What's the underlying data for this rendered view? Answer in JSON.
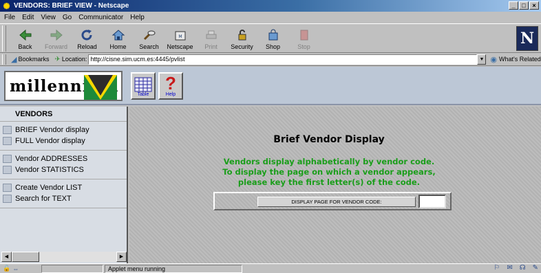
{
  "window": {
    "title": "VENDORS: BRIEF VIEW - Netscape",
    "minimize": "_",
    "maximize": "□",
    "close": "×"
  },
  "menu": [
    "File",
    "Edit",
    "View",
    "Go",
    "Communicator",
    "Help"
  ],
  "toolbar": {
    "back": "Back",
    "forward": "Forward",
    "reload": "Reload",
    "home": "Home",
    "search": "Search",
    "netscape": "Netscape",
    "print": "Print",
    "security": "Security",
    "shop": "Shop",
    "stop": "Stop"
  },
  "brand_letter": "N",
  "location_bar": {
    "bookmarks": "Bookmarks",
    "location_label": "Location:",
    "url": "http://cisne.sim.ucm.es:4445/pvlist",
    "related": "What's Related"
  },
  "app": {
    "logo_text": "millennium",
    "table_label": "Table",
    "help_label": "Help",
    "help_glyph": "?"
  },
  "sidebar": {
    "title": "VENDORS",
    "groups": [
      [
        "BRIEF Vendor display",
        "FULL Vendor display"
      ],
      [
        "Vendor ADDRESSES",
        "Vendor STATISTICS"
      ],
      [
        "Create Vendor LIST",
        "Search for TEXT"
      ]
    ]
  },
  "main": {
    "heading": "Brief Vendor Display",
    "desc_lines": [
      "Vendors display alphabetically by vendor code.",
      "To display the page on which a vendor appears,",
      "please key the first letter(s) of the code."
    ],
    "button_label": "DISPLAY PAGE FOR VENDOR CODE:",
    "code_value": ""
  },
  "status": {
    "text": "Applet menu running"
  },
  "colors": {
    "title_bar": "#0a246a",
    "accent_green": "#1a9e1a",
    "logo_triangle": "#2c2c2c",
    "logo_yellow": "#f4d800",
    "logo_green": "#1e8a3a"
  }
}
